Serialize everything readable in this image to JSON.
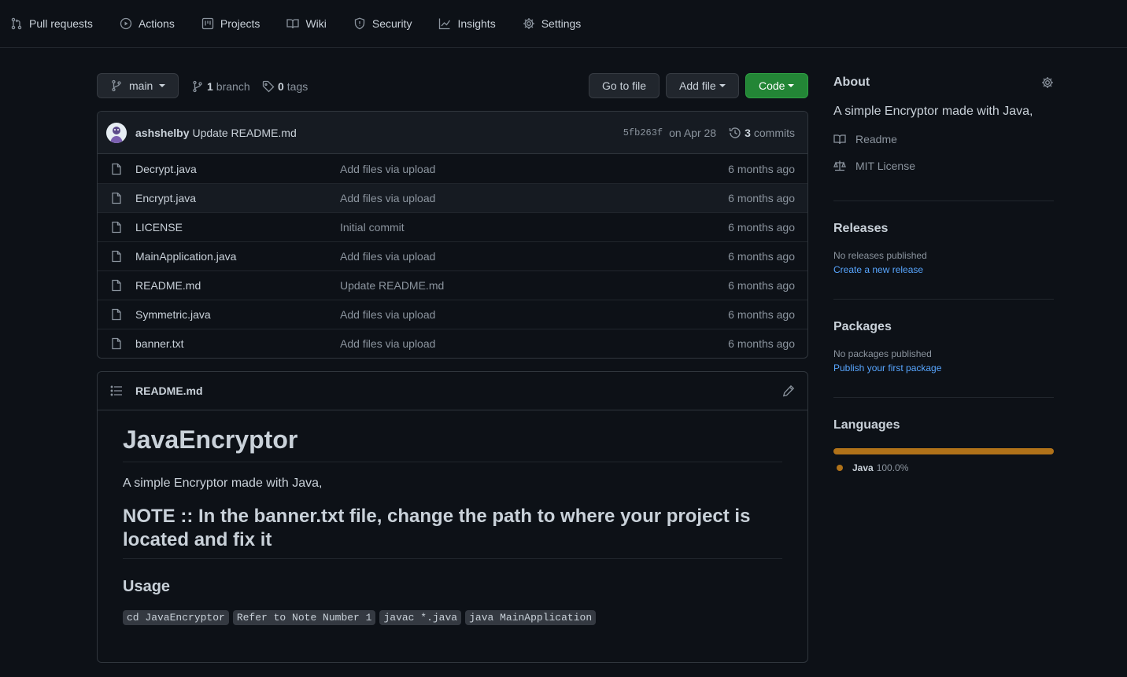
{
  "nav": {
    "items": [
      {
        "label": "Pull requests",
        "icon": "pull-request-icon"
      },
      {
        "label": "Actions",
        "icon": "play-icon"
      },
      {
        "label": "Projects",
        "icon": "project-icon"
      },
      {
        "label": "Wiki",
        "icon": "book-icon"
      },
      {
        "label": "Security",
        "icon": "shield-icon"
      },
      {
        "label": "Insights",
        "icon": "graph-icon"
      },
      {
        "label": "Settings",
        "icon": "gear-icon"
      }
    ]
  },
  "branchbar": {
    "branch": "main",
    "branch_count": "1",
    "branch_word": "branch",
    "tag_count": "0",
    "tag_word": "tags",
    "go_to_file": "Go to file",
    "add_file": "Add file",
    "code": "Code"
  },
  "commit": {
    "author": "ashshelby",
    "message": "Update README.md",
    "sha": "5fb263f",
    "date": "on Apr 28",
    "count": "3",
    "count_word": "commits"
  },
  "files": [
    {
      "name": "Decrypt.java",
      "message": "Add files via upload",
      "age": "6 months ago"
    },
    {
      "name": "Encrypt.java",
      "message": "Add files via upload",
      "age": "6 months ago"
    },
    {
      "name": "LICENSE",
      "message": "Initial commit",
      "age": "6 months ago"
    },
    {
      "name": "MainApplication.java",
      "message": "Add files via upload",
      "age": "6 months ago"
    },
    {
      "name": "README.md",
      "message": "Update README.md",
      "age": "6 months ago"
    },
    {
      "name": "Symmetric.java",
      "message": "Add files via upload",
      "age": "6 months ago"
    },
    {
      "name": "banner.txt",
      "message": "Add files via upload",
      "age": "6 months ago"
    }
  ],
  "readme": {
    "filename": "README.md",
    "h1": "JavaEncryptor",
    "intro": "A simple Encryptor made with Java,",
    "note": "NOTE :: In the banner.txt file, change the path to where your project is located and fix it",
    "usage_heading": "Usage",
    "code_snippets": [
      "cd JavaEncryptor",
      "Refer to Note Number 1",
      "javac *.java",
      "java MainApplication"
    ]
  },
  "sidebar": {
    "about_heading": "About",
    "description": "A simple Encryptor made with Java,",
    "readme_link": "Readme",
    "license_link": "MIT License",
    "releases_heading": "Releases",
    "releases_none": "No releases published",
    "releases_create": "Create a new release",
    "packages_heading": "Packages",
    "packages_none": "No packages published",
    "packages_publish": "Publish your first package",
    "languages_heading": "Languages",
    "language": {
      "name": "Java",
      "percent": "100.0%",
      "fraction": 1.0,
      "color": "#b07219"
    }
  },
  "colors": {
    "background": "#0d1117",
    "accent_green": "#238636",
    "link_blue": "#58a6ff",
    "muted": "#8b949e"
  }
}
